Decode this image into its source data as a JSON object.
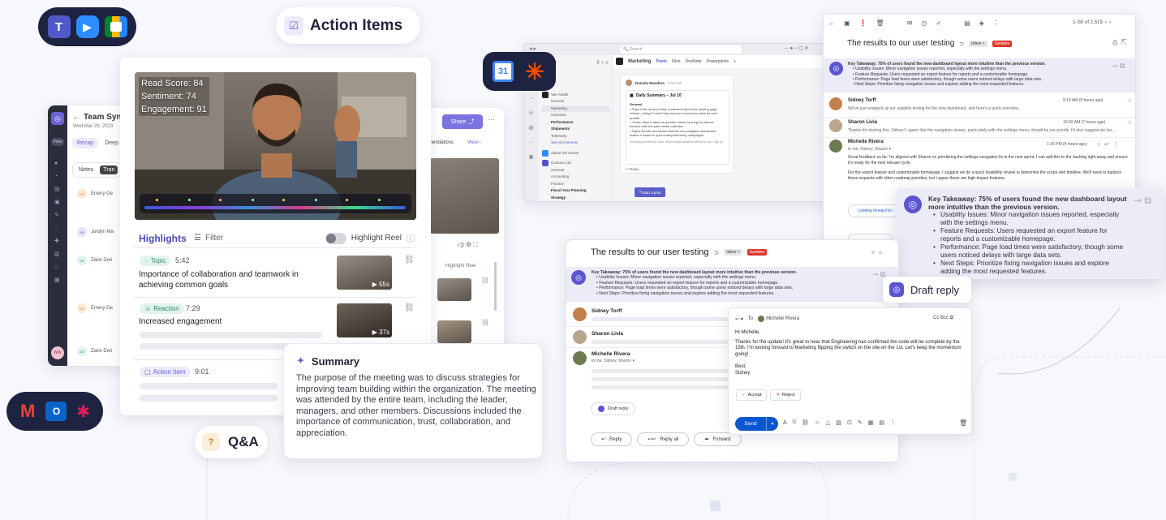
{
  "app_badges": {
    "top": [
      "Teams",
      "Zoom",
      "Google Meet"
    ],
    "bottom": [
      "Gmail",
      "Outlook",
      "Slack"
    ],
    "center": [
      "Google Calendar",
      "Zapier"
    ]
  },
  "action_items_pill": {
    "label": "Action Items"
  },
  "qa_pill": {
    "label": "Q&A"
  },
  "draft_reply_pill": {
    "label": "Draft reply"
  },
  "meeting_panel": {
    "back_title": "Team Syn",
    "date": "Wed Mar 29, 2023",
    "tabs": [
      "Recap",
      "Deep"
    ],
    "subtabs": [
      "Notes",
      "Tran"
    ],
    "people": [
      "Emery Ge",
      "Jordyn Ma",
      "Zaire Dori",
      "Emery Ge",
      "Zaire Dori"
    ],
    "initials": [
      "EG",
      "JM",
      "ZD",
      "EG",
      "ZD"
    ],
    "sidebar_badge": "Free",
    "avatar_initials": "WW"
  },
  "video_panel": {
    "metrics": [
      "Read Score: 84",
      "Sentiment: 74",
      "Engagement: 91"
    ],
    "highlights_title": "Highlights",
    "filter_label": "Filter",
    "highlight_reel_label": "Highlight Reel",
    "items": [
      {
        "tag": "Topic",
        "time": "5:42",
        "text": "Importance of collaboration and teamwork in achieving common goals",
        "duration": "55s"
      },
      {
        "tag": "Reaction",
        "time": "7:29",
        "text": "Increased engagement",
        "duration": "37s"
      },
      {
        "tag": "Action Item",
        "time": "9:01",
        "text": "",
        "duration": ""
      }
    ]
  },
  "back_panel": {
    "share_label": "Share",
    "recs_label": "mmendations",
    "view_label": "View",
    "highlight_reel_label": "Highlight Reel"
  },
  "summary": {
    "title": "Summary",
    "body": "The purpose of the meeting was to discuss strategies for improving team building within the organization. The meeting was attended by the entire team, including the leader, managers, and other members. Discussions  included the importance of communication, trust, collaboration, and appreciation."
  },
  "slack_window": {
    "search_placeholder": "Search",
    "channel": "Marketing",
    "channel_tabs": [
      "Posts",
      "Files",
      "OneNote",
      "Powerpoints"
    ],
    "sidebar_items": [
      "General",
      "Marketing",
      "Overview",
      "Performance",
      "Shipments",
      "Telemetry",
      "See all channels",
      "General",
      "Accounting",
      "Finance",
      "Fiscal Year Planning",
      "Strategy"
    ],
    "teams": [
      "Van Arsdel",
      "Alpine Ski House",
      "Contoso Ltd."
    ],
    "poster": "Daniela Mandera",
    "post_time": "4:00 AM",
    "summary_title": "Daily Summary – Jul 10",
    "summary_section": "General",
    "bullets": [
      "Priya Chen shared early excitement about the landing page refresh, noting it could help improve conversion rates by next quarter.",
      "Jordan Myers raised a question about syncing the launch timeline with the paid media calendar.",
      "Taylor Brooks mentioned that the new analytics dashboard makes it easier to spot underperforming campaigns."
    ],
    "footer": "Summary provided by Leexi. Want insights delivered directly to you? Sign up",
    "reply": "Reply",
    "start_post": "Start a post"
  },
  "gmail_top": {
    "pager": "1–50 of 2,619",
    "subject": "The results to our user testing",
    "label_inbox": "Inbox ×",
    "label_updates": "Updates",
    "takeaway_title": "Key Takeaway: 75% of users found the new dashboard layout more intuitive than the previous version.",
    "bullets": [
      "Usability Issues: Minor navigation issues reported, especially with the settings menu.",
      "Feature Requests: Users requested an export feature for reports and a customizable homepage.",
      "Performance: Page load times were satisfactory, though some users noticed delays with large data sets.",
      "Next Steps: Prioritize fixing navigation issues and explore adding the most requested features."
    ],
    "emails": [
      {
        "name": "Sidney Torff",
        "time": "9:14 AM (8 hours ago)",
        "snippet": "We've just wrapped up our usability testing for the new dashboard, and here's a quick overview..."
      },
      {
        "name": "Sharon Livia",
        "time": "10:02 AM (7 hours ago)",
        "snippet": "Thanks for sharing this, Sidney! I agree that the navigation issues, particularly with the settings menu, should be our priority. I'd also suggest we loo..."
      },
      {
        "name": "Michelle Rivera",
        "time": "1:36 PM (4 hours ago)",
        "snippet": "to me, Sidney, Sharon"
      }
    ],
    "body1": "Great feedback so far. I'm aligned with Sharon on prioritizing the settings navigation fix in the next sprint. I can add this to the backlog right away and ensure it's ready for the next release cycle.",
    "body2": "For the export feature and customizable homepage, I suggest we do a quick feasibility review to determine the scope and timeline. We'll need to balance these requests with other roadmap priorities, but I agree these are high-impact features.",
    "forward_snip": "Looking forward to i"
  },
  "gmail_mid": {
    "subject": "The results to our user testing",
    "label_inbox": "Inbox ×",
    "label_updates": "Updates",
    "names": [
      "Sidney Torff",
      "Sharon Livia",
      "Michelle Rivera"
    ],
    "to_line": "to me, Sidney, Sharon",
    "draft_reply": "Draft reply",
    "actions": [
      "Reply",
      "Reply all",
      "Forward"
    ]
  },
  "compose": {
    "to_label": "To",
    "recipient": "Michelle Rivera",
    "cc_bcc": "Cc Bcc",
    "greeting": "Hi Michelle,",
    "body": "Thanks for the update! It's great to hear that Engineering has confirmed the code will be complete by the 15th. I'm looking forward to Marketing flipping the switch on the site on the 1st. Let's keep the momentum going!",
    "signoff": "Best,",
    "name": "Sidney",
    "accept": "Accept",
    "reject": "Reject",
    "send": "Send"
  },
  "colors": {
    "accent": "#6b63d8",
    "purple_light": "#ecebfb",
    "gmail_red": "#e0352b",
    "teams": "#5059c9",
    "slack_purple": "#4a154b",
    "green": "#2e9e5b"
  }
}
